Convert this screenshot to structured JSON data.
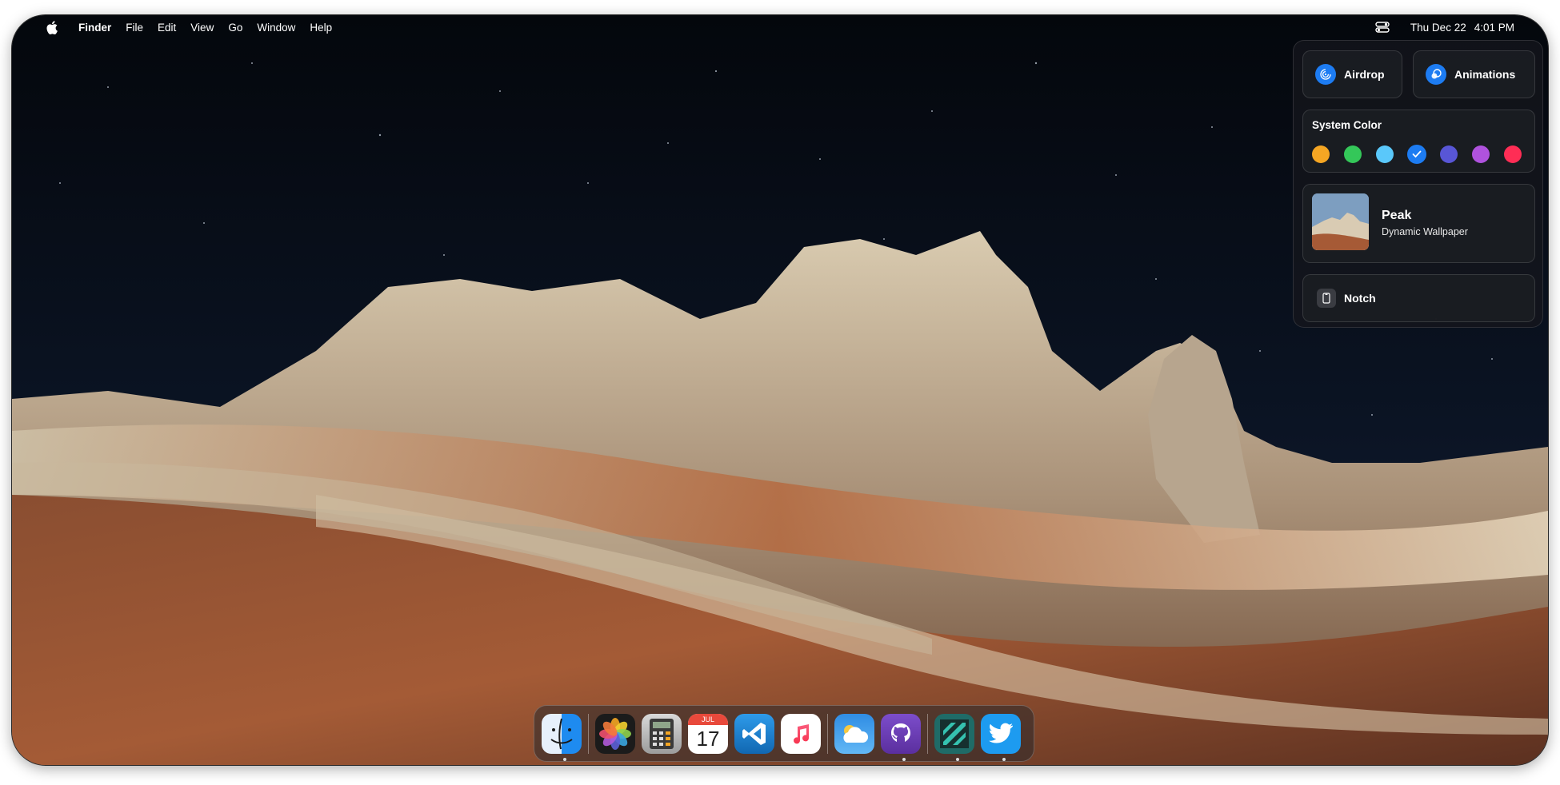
{
  "menubar": {
    "app_name": "Finder",
    "items": [
      "File",
      "Edit",
      "View",
      "Go",
      "Window",
      "Help"
    ],
    "date": "Thu Dec 22",
    "time": "4:01 PM"
  },
  "control_center": {
    "airdrop_label": "Airdrop",
    "animations_label": "Animations",
    "system_color": {
      "title": "System Color",
      "colors": [
        "#f5a623",
        "#34c759",
        "#5ac8fa",
        "#1d7cf2",
        "#5856d6",
        "#af52de",
        "#ff2d55"
      ],
      "selected": "#1d7cf2"
    },
    "wallpaper": {
      "name": "Peak",
      "subtitle": "Dynamic Wallpaper"
    },
    "notch_label": "Notch"
  },
  "dock": {
    "apps": [
      {
        "name": "finder",
        "running": true
      },
      {
        "name": "photos",
        "running": false
      },
      {
        "name": "calculator",
        "running": false
      },
      {
        "name": "calendar",
        "running": false,
        "month": "JUL",
        "day": "17"
      },
      {
        "name": "vscode",
        "running": false
      },
      {
        "name": "music",
        "running": false
      },
      {
        "name": "weather",
        "running": false
      },
      {
        "name": "github",
        "running": true
      },
      {
        "name": "spotify-like",
        "running": true
      },
      {
        "name": "twitter",
        "running": true
      }
    ]
  }
}
